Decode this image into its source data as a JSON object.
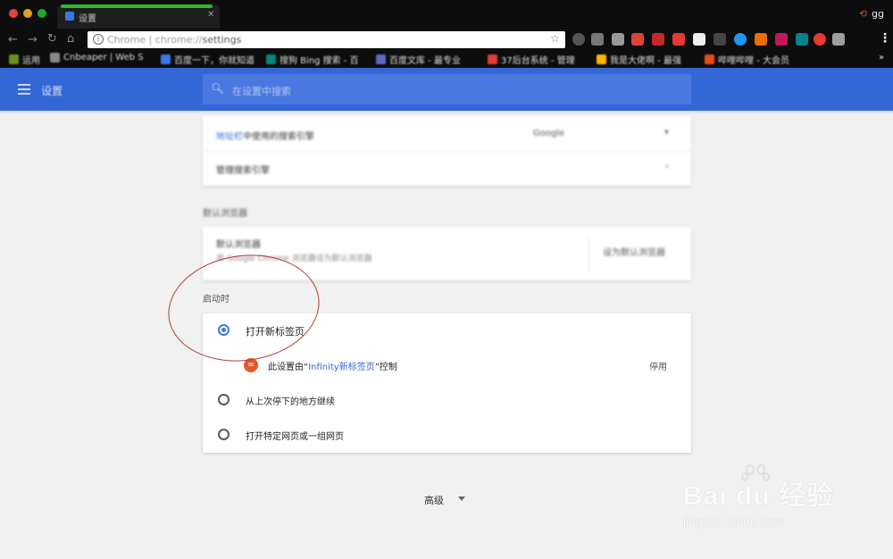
{
  "browser": {
    "tab_title": "设置",
    "url_scheme": "Chrome",
    "url_host": " | chrome://",
    "url_path": "settings",
    "profile_name": "gg",
    "bookmarks": [
      {
        "label": "运用",
        "color": "#6b8e23"
      },
      {
        "label": "Cnbeaper | Web S",
        "color": "#888888"
      },
      {
        "label": "百度一下，你就知道",
        "color": "#3b78e7"
      },
      {
        "label": "搜狗 Bing 搜索 - 百",
        "color": "#00897b"
      },
      {
        "label": "百度文库 - 最专业",
        "color": "#5c6bc0"
      },
      {
        "label": "37后台系统 - 管理",
        "color": "#e53935"
      },
      {
        "label": "我是大佬啊 - 最强",
        "color": "#ffb300"
      },
      {
        "label": "哔哩哔哩 - 大会员",
        "color": "#e64a19"
      }
    ],
    "bookmarks_more": "»"
  },
  "settings": {
    "header_title": "设置",
    "search_placeholder": "在设置中搜索",
    "search_engine": {
      "row1_link": "地址栏",
      "row1_label": "中使用的搜索引擎",
      "row1_value": "Google",
      "row2_label": "管理搜索引擎"
    },
    "default_browser": {
      "section_title": "默认浏览器",
      "label": "默认浏览器",
      "sub": "将 Google Chrome 浏览器设为默认浏览器",
      "button": "设为默认浏览器"
    },
    "startup": {
      "section_title": "启动时",
      "options": [
        {
          "label": "打开新标签页",
          "checked": true
        },
        {
          "label": "从上次停下的地方继续",
          "checked": false
        },
        {
          "label": "打开特定网页或一组网页",
          "checked": false
        }
      ],
      "extension_prefix": "此设置由“",
      "extension_name": "Infinity新标签页",
      "extension_suffix": "”控制",
      "disable_label": "停用"
    },
    "advanced_label": "高级"
  },
  "watermark": {
    "main": "Bai  du 经验",
    "url": "jingyan.baidu.com"
  }
}
